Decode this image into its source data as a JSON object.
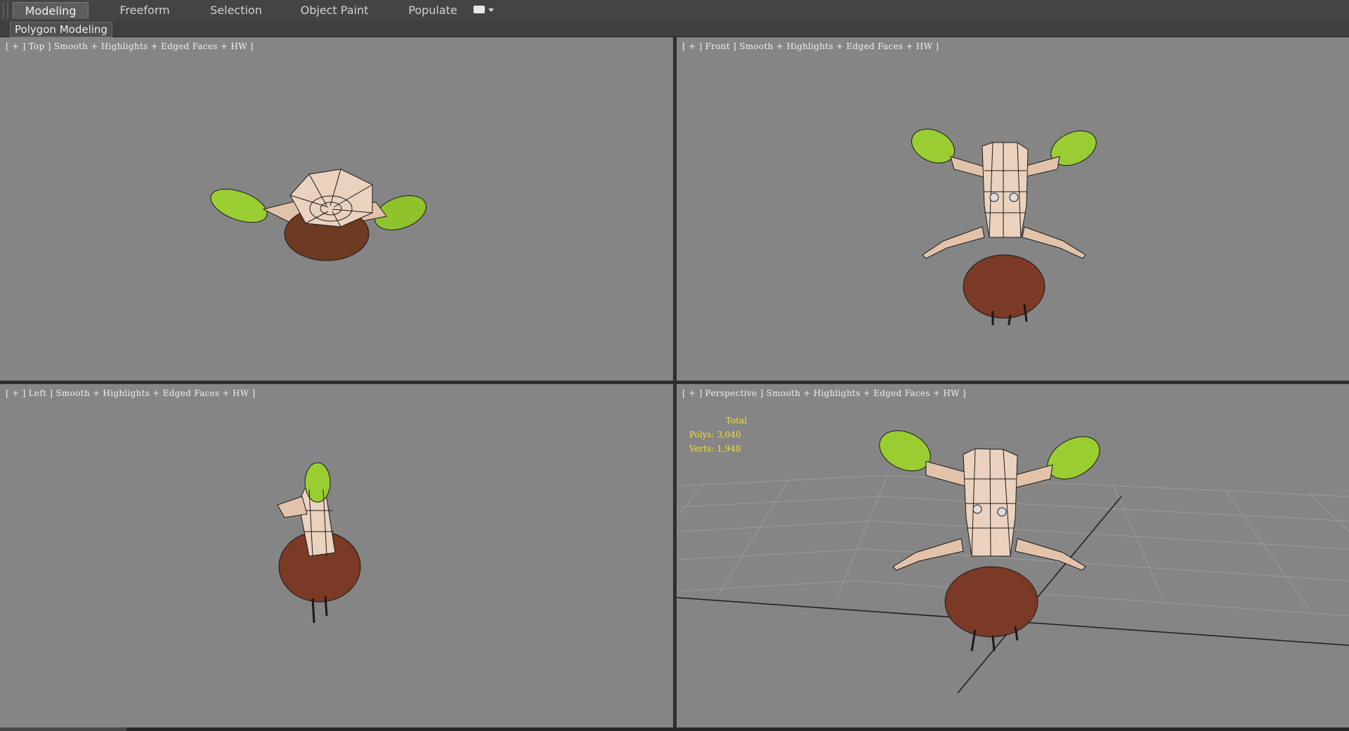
{
  "ribbon": {
    "tabs": [
      {
        "label": "Modeling",
        "active": true
      },
      {
        "label": "Freeform",
        "active": false
      },
      {
        "label": "Selection",
        "active": false
      },
      {
        "label": "Object Paint",
        "active": false
      },
      {
        "label": "Populate",
        "active": false
      }
    ],
    "dropdown_icon": "panel-options-icon"
  },
  "panel": {
    "label": "Polygon Modeling"
  },
  "viewports": {
    "top": {
      "label": "[ + ] Top ] Smooth + Highlights + Edged Faces + HW ]"
    },
    "front": {
      "label": "[ + ] Front ] Smooth + Highlights + Edged Faces + HW ]"
    },
    "left": {
      "label": "[ + ] Left ] Smooth + Highlights + Edged Faces + HW ]"
    },
    "perspective": {
      "label": "[ + ] Perspective ] Smooth + Highlights + Edged Faces + HW ]",
      "stats": {
        "total": "Total",
        "polys": "Polys: 3,040",
        "verts": "Verts: 1,948"
      }
    }
  },
  "colors": {
    "viewport_bg": "#858585",
    "stats_text": "#f2e02c",
    "bark": "#e2c3aa",
    "leaf": "#9acd32",
    "rock": "#7a3a26"
  }
}
